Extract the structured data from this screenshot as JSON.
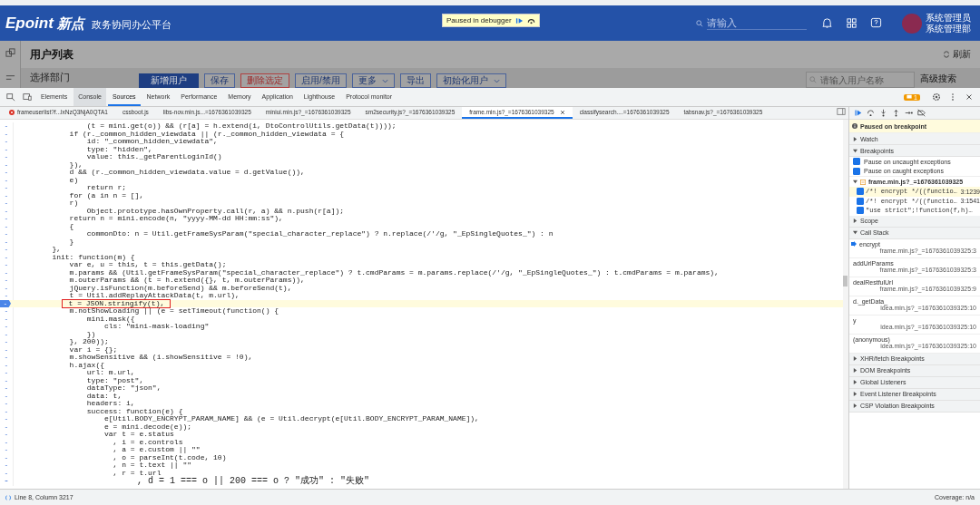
{
  "app": {
    "logo_brand": "Epoint",
    "logo_cn": "新点",
    "platform": "政务协同办公平台",
    "debugger_banner": "Paused in debugger",
    "search_placeholder": "请输入",
    "user_name": "系统管理员",
    "user_dept": "系统管理部",
    "page_title": "用户列表",
    "refresh": "刷新",
    "dept_label": "选择部门",
    "buttons": [
      {
        "label": "新增用户",
        "kind": "primary"
      },
      {
        "label": "保存",
        "kind": "default"
      },
      {
        "label": "删除选定",
        "kind": "danger"
      },
      {
        "label": "启用/禁用",
        "kind": "default"
      },
      {
        "label": "更多",
        "kind": "dropdown"
      },
      {
        "label": "导出",
        "kind": "default"
      },
      {
        "label": "初始化用户",
        "kind": "dropdown"
      }
    ],
    "user_search_placeholder": "请输入用户名称",
    "advanced_search": "高级搜索"
  },
  "devtools": {
    "tabs": [
      {
        "label": "Elements",
        "selected": false,
        "hovered": false
      },
      {
        "label": "Console",
        "selected": false,
        "hovered": true
      },
      {
        "label": "Sources",
        "selected": true,
        "hovered": false
      },
      {
        "label": "Network",
        "selected": false,
        "hovered": false
      },
      {
        "label": "Performance",
        "selected": false,
        "hovered": false
      },
      {
        "label": "Memory",
        "selected": false,
        "hovered": false
      },
      {
        "label": "Application",
        "selected": false,
        "hovered": false
      },
      {
        "label": "Lighthouse",
        "selected": false,
        "hovered": false
      },
      {
        "label": "Protocol monitor",
        "selected": false,
        "hovered": false
      }
    ],
    "issues_count": "1",
    "file_tabs": [
      {
        "label": "frameuserlist?f...lxNzQ3NjA0QTA1",
        "selected": false,
        "error": true
      },
      {
        "label": "cssboot.js",
        "selected": false,
        "error": false
      },
      {
        "label": "libs-nov.min.js...=1676361039325",
        "selected": false,
        "error": false
      },
      {
        "label": "miniui.min.js?_=1676361039325",
        "selected": false,
        "error": false
      },
      {
        "label": "sm2security.js?_=1676361039325",
        "selected": false,
        "error": false
      },
      {
        "label": "frame.min.js?_=1676361039325",
        "selected": true,
        "error": false
      },
      {
        "label": "classifysearch....=1676361039325",
        "selected": false,
        "error": false
      },
      {
        "label": "tabsnav.js?_=1676361039325",
        "selected": false,
        "error": false
      }
    ],
    "code_lines": [
      {
        "gutter": "-",
        "code": "                (t = mini.get(o)) && (r[a] = h.extend(i, DtoControlUtils.getData(t))));",
        "current": false,
        "boxed": false
      },
      {
        "gutter": "-",
        "code": "            if (r._common_hidden_viewdata || (r._common_hidden_viewdata = {",
        "current": false,
        "boxed": false
      },
      {
        "gutter": "-",
        "code": "                id: \"_common_hidden_viewdata\",",
        "current": false,
        "boxed": false
      },
      {
        "gutter": "-",
        "code": "                type: \"hidden\",",
        "current": false,
        "boxed": false
      },
      {
        "gutter": "-",
        "code": "                value: this._getParentLoginId()",
        "current": false,
        "boxed": false
      },
      {
        "gutter": "-",
        "code": "            }),",
        "current": false,
        "boxed": false
      },
      {
        "gutter": "-",
        "code": "            d && (r._common_hidden_viewdata.value = d.getValue()),",
        "current": false,
        "boxed": false
      },
      {
        "gutter": "-",
        "code": "            e)",
        "current": false,
        "boxed": false
      },
      {
        "gutter": "-",
        "code": "                return r;",
        "current": false,
        "boxed": false
      },
      {
        "gutter": "-",
        "code": "            for (a in n = [],",
        "current": false,
        "boxed": false
      },
      {
        "gutter": "-",
        "code": "            r)",
        "current": false,
        "boxed": false
      },
      {
        "gutter": "-",
        "code": "                Object.prototype.hasOwnProperty.call(r, a) && n.push(r[a]);",
        "current": false,
        "boxed": false
      },
      {
        "gutter": "-",
        "code": "            return n = mini.encode(n, \"yyyy-MM-dd HH:mm:ss\"),",
        "current": false,
        "boxed": false
      },
      {
        "gutter": "-",
        "code": "            {",
        "current": false,
        "boxed": false
      },
      {
        "gutter": "-",
        "code": "                commonDto: n = Util.getFrameSysParam(\"special_character_replace\") ? n.replace(/'/g, \"_EpSingleQuotes_\") : n",
        "current": false,
        "boxed": false
      },
      {
        "gutter": "-",
        "code": "            }",
        "current": false,
        "boxed": false
      },
      {
        "gutter": "-",
        "code": "        },",
        "current": false,
        "boxed": false
      },
      {
        "gutter": "-",
        "code": "        init: function(m) {",
        "current": false,
        "boxed": false
      },
      {
        "gutter": "-",
        "code": "            var e, u = this, t = this.getData();",
        "current": false,
        "boxed": false
      },
      {
        "gutter": "-",
        "code": "            m.params && (Util.getFrameSysParam(\"special_character_replace\") ? t.cmdParams = m.params.replace(/'/g, \"_EpSingleQuotes_\") : t.cmdParams = m.params),",
        "current": false,
        "boxed": false
      },
      {
        "gutter": "-",
        "code": "            m.outerParams && (t = h.extend({}, t, m.outerParams)),",
        "current": false,
        "boxed": false
      },
      {
        "gutter": "-",
        "code": "            jQuery.isFunction(m.beforeSend) && m.beforeSend(t),",
        "current": false,
        "boxed": false
      },
      {
        "gutter": "-",
        "code": "            t = Util.addReplayAttackData(t, m.url),",
        "current": false,
        "boxed": false
      },
      {
        "gutter": "-",
        "code": "            t = JSON.stringify(t),",
        "current": true,
        "boxed": true
      },
      {
        "gutter": "-",
        "code": "            m.notShowLoading || (e = setTimeout(function() {",
        "current": false,
        "boxed": false
      },
      {
        "gutter": "-",
        "code": "                mini.mask({",
        "current": false,
        "boxed": false
      },
      {
        "gutter": "-",
        "code": "                    cls: \"mini-mask-loading\"",
        "current": false,
        "boxed": false
      },
      {
        "gutter": "-",
        "code": "                })",
        "current": false,
        "boxed": false
      },
      {
        "gutter": "-",
        "code": "            }, 200));",
        "current": false,
        "boxed": false
      },
      {
        "gutter": "-",
        "code": "            var i = {};",
        "current": false,
        "boxed": false
      },
      {
        "gutter": "-",
        "code": "            m.showSensitive && (i.showSensitive = !0),",
        "current": false,
        "boxed": false
      },
      {
        "gutter": "-",
        "code": "            h.ajax({",
        "current": false,
        "boxed": false
      },
      {
        "gutter": "-",
        "code": "                url: m.url,",
        "current": false,
        "boxed": false
      },
      {
        "gutter": "-",
        "code": "                type: \"post\",",
        "current": false,
        "boxed": false
      },
      {
        "gutter": "-",
        "code": "                dataType: \"json\",",
        "current": false,
        "boxed": false
      },
      {
        "gutter": "-",
        "code": "                data: t,",
        "current": false,
        "boxed": false
      },
      {
        "gutter": "-",
        "code": "                headers: i,",
        "current": false,
        "boxed": false
      },
      {
        "gutter": "-",
        "code": "                success: function(e) {",
        "current": false,
        "boxed": false
      },
      {
        "gutter": "-",
        "code": "                    e[Util.BODY_ENCRYPT_PARAM_NAME] && (e = Util.decrypt(e[Util.BODY_ENCRYPT_PARAM_NAME]),",
        "current": false,
        "boxed": false
      },
      {
        "gutter": "-",
        "code": "                    e = mini.decode(e));",
        "current": false,
        "boxed": false
      },
      {
        "gutter": "-",
        "code": "                    var t = e.status",
        "current": false,
        "boxed": false
      },
      {
        "gutter": "-",
        "code": "                      , i = e.controls",
        "current": false,
        "boxed": false
      },
      {
        "gutter": "-",
        "code": "                      , a = e.custom || \"\"",
        "current": false,
        "boxed": false
      },
      {
        "gutter": "-",
        "code": "                      , o = parseInt(t.code, 10)",
        "current": false,
        "boxed": false
      },
      {
        "gutter": "-",
        "code": "                      , n = t.text || \"\"",
        "current": false,
        "boxed": false
      },
      {
        "gutter": "-",
        "code": "                      , r = t.url",
        "current": false,
        "boxed": false
      },
      {
        "gutter": "-",
        "code": "                      , d = 1 === o || 200 === o ? \"成功\" : \"失败\"",
        "current": false,
        "boxed": false
      }
    ],
    "status_position": "Line 8, Column 3217",
    "coverage": "Coverage: n/a"
  },
  "debugger": {
    "pause_message": "Paused on breakpoint",
    "sections": [
      {
        "title": "Watch",
        "expanded": false
      },
      {
        "title": "Breakpoints",
        "expanded": true,
        "items": [
          {
            "kind": "checkbox",
            "label": "Pause on uncaught exceptions",
            "checked": true
          },
          {
            "kind": "checkbox",
            "label": "Pause on caught exceptions",
            "checked": true
          },
          {
            "kind": "file",
            "label": "frame.min.js?_=1676361039325",
            "expanded": true
          },
          {
            "kind": "breakpoint",
            "code": "/*! encrypt */((functio…",
            "location": "3:1239",
            "checked": true,
            "selected": true
          },
          {
            "kind": "breakpoint",
            "code": "/*! encrypt */((functio…",
            "location": "3:1541",
            "checked": true,
            "selected": false
          },
          {
            "kind": "breakpoint",
            "code": "\"use strict\";!function(f,h)…",
            "checked": true,
            "selected": false
          }
        ]
      },
      {
        "title": "Scope",
        "expanded": false
      },
      {
        "title": "Call Stack",
        "expanded": true,
        "items": [
          {
            "kind": "frame",
            "name": "encrypt",
            "location": "frame.min.js?_=1676361039325:3",
            "current": true
          },
          {
            "kind": "frame",
            "name": "addUrlParams",
            "location": "frame.min.js?_=1676361039325:3",
            "current": false
          },
          {
            "kind": "frame",
            "name": "dealRestfulUrl",
            "location": "frame.min.js?_=1676361039325:9",
            "current": false
          },
          {
            "kind": "frame",
            "name": "d._getData_",
            "location": "idea.min.js?_=1676361039325:10",
            "current": false
          },
          {
            "kind": "frame",
            "name": "y",
            "location": "idea.min.js?_=1676361039325:10",
            "current": false
          },
          {
            "kind": "frame",
            "name": "(anonymous)",
            "location": "idea.min.js?_=1676361039325:10",
            "current": false
          }
        ]
      },
      {
        "title": "XHR/fetch Breakpoints",
        "expanded": false
      },
      {
        "title": "DOM Breakpoints",
        "expanded": false
      },
      {
        "title": "Global Listeners",
        "expanded": false
      },
      {
        "title": "Event Listener Breakpoints",
        "expanded": false
      },
      {
        "title": "CSP Violation Breakpoints",
        "expanded": false
      }
    ]
  }
}
